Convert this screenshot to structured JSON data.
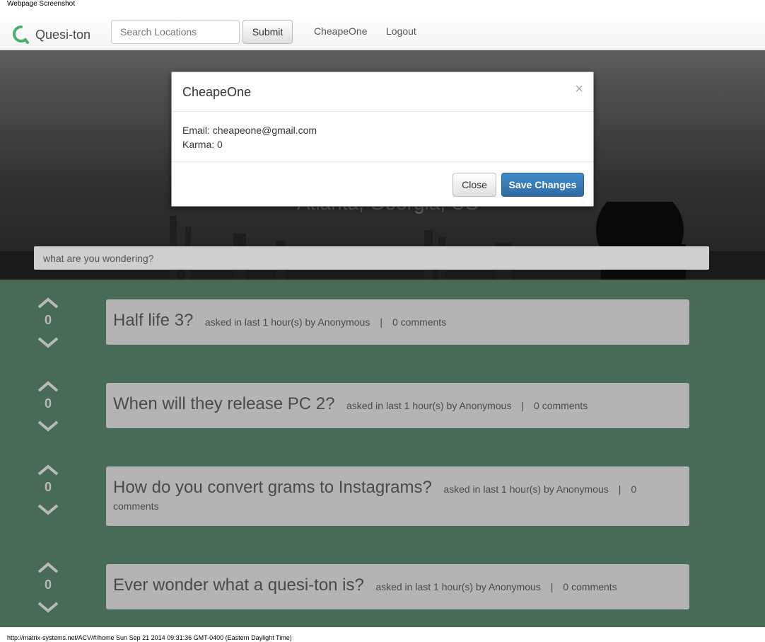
{
  "page": {
    "print_title": "Webpage Screenshot",
    "footer": "http://matrix-systems.net/ACV/#/home Sun Sep 21 2014 09:31:36 GMT-0400 (Eastern Daylight Time)"
  },
  "navbar": {
    "brand": "Quesi-ton",
    "search_placeholder": "Search Locations",
    "submit_label": "Submit",
    "user_link": "CheapeOne",
    "logout_link": "Logout"
  },
  "hero": {
    "location": "Atlanta, Georgia, US",
    "ask_placeholder": "what are you wondering?"
  },
  "questions": [
    {
      "title": "Half life 3?",
      "meta": "asked in last 1 hour(s) by Anonymous",
      "comments": "0 comments",
      "votes": "0"
    },
    {
      "title": "When will they release PC 2?",
      "meta": "asked in last 1 hour(s) by Anonymous",
      "comments": "0 comments",
      "votes": "0"
    },
    {
      "title": "How do you convert grams to Instagrams?",
      "meta": "asked in last 1 hour(s) by Anonymous",
      "comments": "0 comments",
      "votes": "0"
    },
    {
      "title": "Ever wonder what a quesi-ton is?",
      "meta": "asked in last 1 hour(s) by Anonymous",
      "comments": "0 comments",
      "votes": "0"
    }
  ],
  "separator": "|",
  "modal": {
    "title": "CheapeOne",
    "close_glyph": "×",
    "email": "Email: cheapeone@gmail.com",
    "karma": "Karma: 0",
    "close_label": "Close",
    "save_label": "Save Changes"
  },
  "icons": {
    "logo": "brand-logo-icon",
    "close": "close-icon",
    "upvote": "chevron-up-icon",
    "downvote": "chevron-down-icon"
  },
  "colors": {
    "brand_green": "#4caf6e",
    "questions_bg": "#486b58",
    "card_bg": "#b4b4b4",
    "primary_button": "#428bca"
  }
}
